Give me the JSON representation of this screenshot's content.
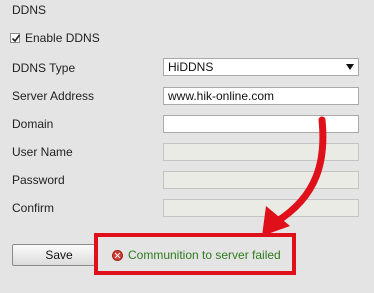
{
  "section": {
    "title": "DDNS"
  },
  "enable_ddns": {
    "label": "Enable DDNS",
    "checked": true
  },
  "form": {
    "ddns_type": {
      "label": "DDNS Type",
      "value": "HiDDNS"
    },
    "server_address": {
      "label": "Server Address",
      "value": "www.hik-online.com"
    },
    "domain": {
      "label": "Domain",
      "value": ""
    },
    "user_name": {
      "label": "User Name",
      "value": ""
    },
    "password": {
      "label": "Password",
      "value": ""
    },
    "confirm": {
      "label": "Confirm",
      "value": ""
    }
  },
  "actions": {
    "save_label": "Save"
  },
  "status": {
    "message": "Communition to server failed",
    "icon": "error-icon"
  },
  "colors": {
    "highlight": "#e0101a",
    "status_text": "#2f7a1f"
  }
}
